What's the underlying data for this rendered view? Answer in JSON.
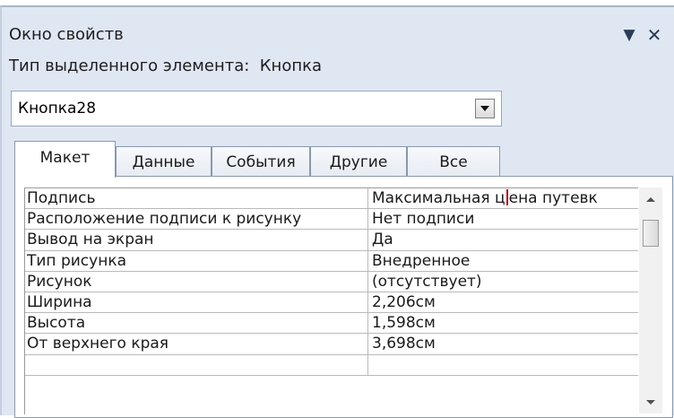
{
  "window": {
    "title": "Окно свойств",
    "dropdown_icon": "chevron-down-icon",
    "close_icon": "close-icon",
    "selection_type_label": "Тип выделенного элемента:",
    "selection_type_value": "Кнопка"
  },
  "object_selector": {
    "value": "Кнопка28"
  },
  "tabs": [
    {
      "label": "Макет",
      "active": true
    },
    {
      "label": "Данные",
      "active": false
    },
    {
      "label": "События",
      "active": false
    },
    {
      "label": "Другие",
      "active": false
    },
    {
      "label": "Все",
      "active": false
    }
  ],
  "properties": [
    {
      "name": "Подпись",
      "value_before_cursor": "Максимальная ц",
      "value_after_cursor": "ена путевк"
    },
    {
      "name": "Расположение подписи к рисунку",
      "value": "Нет подписи"
    },
    {
      "name": "Вывод на экран",
      "value": "Да"
    },
    {
      "name": "Тип рисунка",
      "value": "Внедренное"
    },
    {
      "name": "Рисунок",
      "value": "(отсутствует)"
    },
    {
      "name": "Ширина",
      "value": "2,206см"
    },
    {
      "name": "Высота",
      "value": "1,598см"
    },
    {
      "name": "От верхнего края",
      "value": "3,698см"
    }
  ],
  "colors": {
    "frame_background": "#dfe7f3",
    "text_cursor": "#b01020"
  }
}
